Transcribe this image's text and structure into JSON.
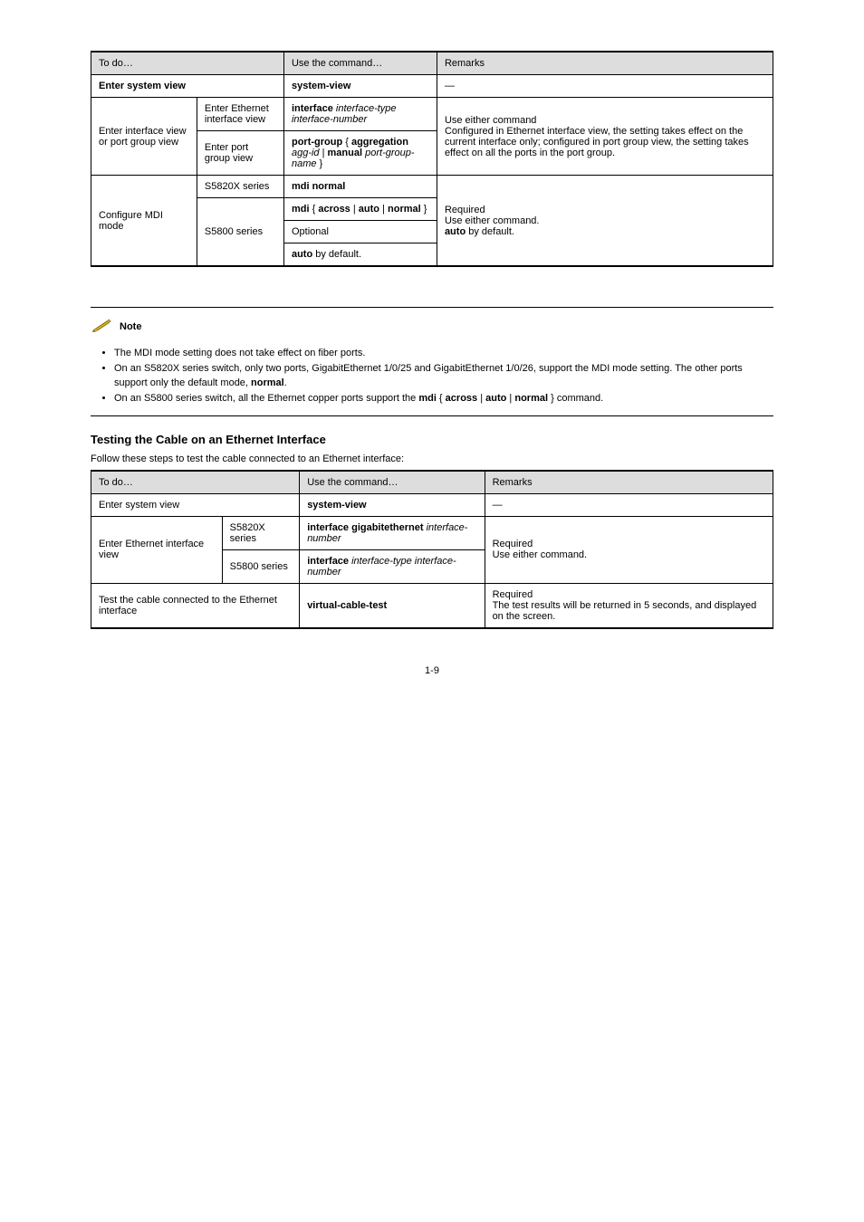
{
  "table1": {
    "headers": {
      "c1": "To do…",
      "c2": "Use the command…",
      "c3": "Remarks"
    },
    "rows": [
      {
        "c1": "Enter system view",
        "c2": "system-view",
        "c3": "—"
      },
      {
        "c1": "Enter interface view or port group view",
        "sub": [
          {
            "label": "Enter Ethernet interface view",
            "cmd": [
              "interface interface-type interface-number"
            ]
          },
          {
            "label": "Enter port group view",
            "cmd": [
              "port-group { aggregation agg-id | manual port-group-name }"
            ]
          }
        ],
        "note": "Use either command\nConfigured in Ethernet interface view, the setting takes effect on the current interface only; configured in port group view, the setting takes effect on all the ports in the port group.",
        "rowspan": 2
      },
      {
        "c1": "Configure MDI mode",
        "sub": [
          {
            "label": "S5820X series",
            "cmd": [
              "mdi normal"
            ]
          },
          {
            "label": "S5800 series",
            "cmd": [
              "mdi { across | auto | normal }",
              "Optional",
              "auto by default."
            ]
          }
        ],
        "note": "Required\nUse either command.\nauto by default.",
        "rowspan": 2
      }
    ]
  },
  "note": {
    "label": "Note",
    "bullets": [
      "The MDI mode setting does not take effect on fiber ports.",
      "On an S5820X series switch, only two ports, GigabitEthernet 1/0/25 and GigabitEthernet 1/0/26, support the MDI mode setting. The other ports support only the default mode, normal.",
      "On an S5800 series switch, all the Ethernet copper ports support the mdi { across | auto | normal } command."
    ]
  },
  "section": {
    "title": "Testing the Cable on an Ethernet Interface",
    "intro": "Follow these steps to test the cable connected to an Ethernet interface:"
  },
  "table2": {
    "headers": {
      "c1": "To do…",
      "c2": "Use the command…",
      "c3": "Remarks"
    },
    "rows": [
      {
        "c1": "Enter system view",
        "c2": "system-view",
        "c3": "—"
      },
      {
        "c1": "Enter Ethernet interface view",
        "sub": [
          {
            "label": "S5820X series",
            "cmd": [
              "interface gigabitethernet interface-number"
            ]
          },
          {
            "label": "S5800 series",
            "cmd": [
              "interface interface-type interface-number"
            ]
          }
        ],
        "note": "Required\nUse either command.",
        "rowspan": 2
      },
      {
        "c1": "Test the cable connected to the Ethernet interface",
        "c2": "virtual-cable-test",
        "c3": "Required\nThe test results will be returned in 5 seconds, and displayed on the screen."
      }
    ]
  },
  "pageNumber": "1-9"
}
